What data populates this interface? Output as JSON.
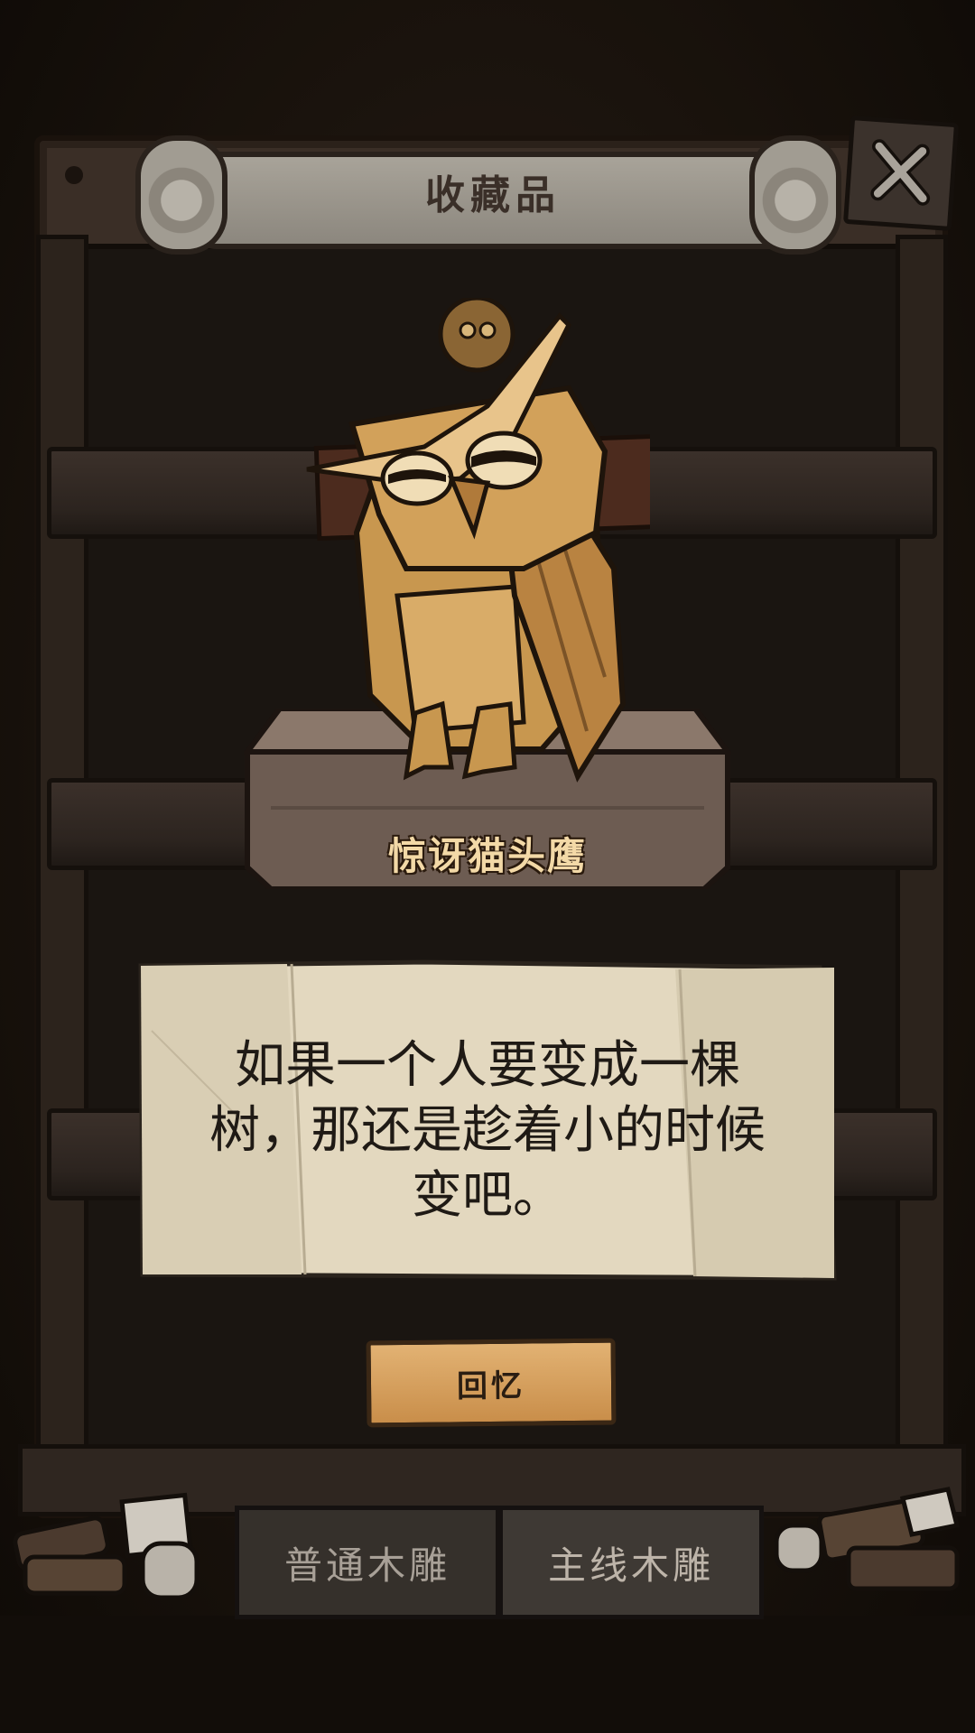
{
  "header": {
    "title": "收藏品"
  },
  "item": {
    "name": "惊讶猫头鹰",
    "description": "如果一个人要变成一棵树，那还是趁着小的时候变吧。"
  },
  "actions": {
    "recall_label": "回忆"
  },
  "tabs": [
    {
      "label": "普通木雕",
      "active": false
    },
    {
      "label": "主线木雕",
      "active": true
    }
  ],
  "icons": {
    "close": "close-x-icon"
  },
  "colors": {
    "background": "#17110b",
    "accent": "#e2b273",
    "paper": "#e8dec6",
    "name_text": "#f3d9a7"
  }
}
